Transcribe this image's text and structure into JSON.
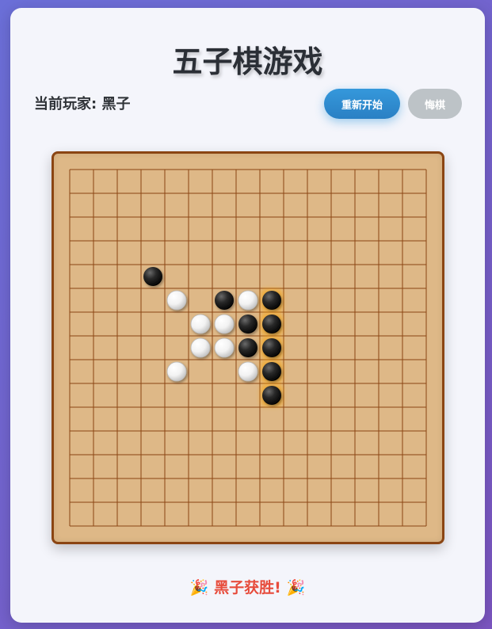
{
  "title": "五子棋游戏",
  "status": {
    "label": "当前玩家:",
    "player": "黑子"
  },
  "buttons": {
    "restart": "重新开始",
    "undo": "悔棋"
  },
  "board": {
    "size": 16,
    "stones": [
      {
        "row": 4,
        "col": 3,
        "color": "black"
      },
      {
        "row": 5,
        "col": 4,
        "color": "white"
      },
      {
        "row": 5,
        "col": 6,
        "color": "black"
      },
      {
        "row": 5,
        "col": 7,
        "color": "white"
      },
      {
        "row": 5,
        "col": 8,
        "color": "black",
        "winning": true
      },
      {
        "row": 6,
        "col": 5,
        "color": "white"
      },
      {
        "row": 6,
        "col": 6,
        "color": "white"
      },
      {
        "row": 6,
        "col": 7,
        "color": "black"
      },
      {
        "row": 6,
        "col": 8,
        "color": "black",
        "winning": true
      },
      {
        "row": 7,
        "col": 5,
        "color": "white"
      },
      {
        "row": 7,
        "col": 6,
        "color": "white"
      },
      {
        "row": 7,
        "col": 7,
        "color": "black"
      },
      {
        "row": 7,
        "col": 8,
        "color": "black",
        "winning": true
      },
      {
        "row": 8,
        "col": 4,
        "color": "white"
      },
      {
        "row": 8,
        "col": 7,
        "color": "white"
      },
      {
        "row": 8,
        "col": 8,
        "color": "black",
        "winning": true
      },
      {
        "row": 9,
        "col": 8,
        "color": "black",
        "winning": true
      }
    ]
  },
  "result": {
    "emoji_left": "🎉",
    "text": "黑子获胜!",
    "emoji_right": "🎉"
  },
  "colors": {
    "board_bg": "#deb887",
    "board_line": "#8b4513",
    "win_glow": "#ffa500",
    "result": "#e74c3c",
    "restart_btn": "#3498db",
    "undo_btn": "#bdc3c7"
  }
}
